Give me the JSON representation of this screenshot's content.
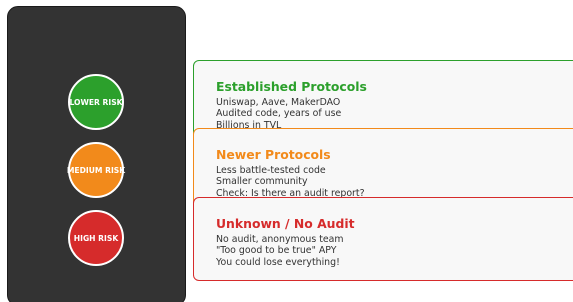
{
  "colors": {
    "low": "#2ca02c",
    "medium": "#f28a1b",
    "high": "#d62b2b",
    "panel": "#333333",
    "card_bg": "#f8f8f8"
  },
  "signal": {
    "low_label": "LOWER RISK",
    "medium_label": "MEDIUM RISK",
    "high_label": "HIGH RISK"
  },
  "cards": [
    {
      "title": "Established Protocols",
      "lines": [
        "Uniswap, Aave, MakerDAO",
        "Audited code, years of use",
        "Billions in TVL"
      ]
    },
    {
      "title": "Newer Protocols",
      "lines": [
        "Less battle-tested code",
        "Smaller community",
        "Check: Is there an audit report?"
      ]
    },
    {
      "title": "Unknown / No Audit",
      "lines": [
        "No audit, anonymous team",
        "\"Too good to be true\" APY",
        "You could lose everything!"
      ]
    }
  ]
}
